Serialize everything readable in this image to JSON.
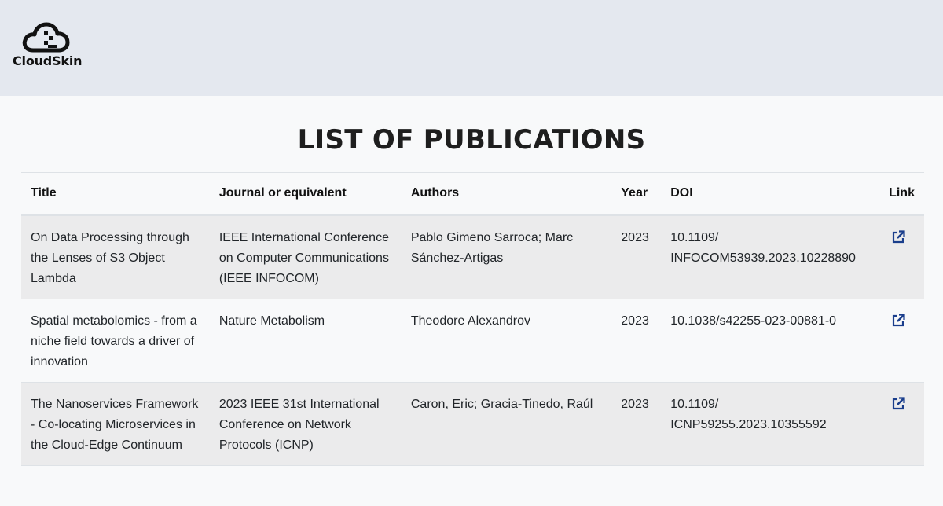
{
  "brand": {
    "name": "CloudSkin"
  },
  "page": {
    "title": "LIST OF PUBLICATIONS"
  },
  "table": {
    "headers": {
      "title": "Title",
      "journal": "Journal or equivalent",
      "authors": "Authors",
      "year": "Year",
      "doi": "DOI",
      "link": "Link"
    },
    "rows": [
      {
        "title": "On Data Processing through the Lenses of S3 Object Lambda",
        "journal": "IEEE International Conference on Computer Communications (IEEE INFOCOM)",
        "authors": "Pablo Gimeno Sarroca; Marc Sánchez-Artigas",
        "year": "2023",
        "doi": "10.1109/ INFOCOM53939.2023.10228890",
        "link_icon": "external-link-icon"
      },
      {
        "title": "Spatial metabolomics - from a niche field towards a driver of innovation",
        "journal": "Nature Metabolism",
        "authors": "Theodore Alexandrov",
        "year": "2023",
        "doi": "10.1038/s42255-023-00881-0",
        "link_icon": "external-link-icon"
      },
      {
        "title": "The Nanoservices Framework - Co-locating Microservices in the Cloud-Edge Continuum",
        "journal": "2023 IEEE 31st International Conference on Network Protocols (ICNP)",
        "authors": "Caron, Eric; Gracia-Tinedo, Raúl",
        "year": "2023",
        "doi": "10.1109/ ICNP59255.2023.10355592",
        "link_icon": "external-link-icon"
      }
    ]
  },
  "colors": {
    "header_bg": "#e4e8ef",
    "page_bg": "#f8f9fa",
    "stripe_bg": "#ebebec",
    "link_icon": "#1a3e8c"
  }
}
